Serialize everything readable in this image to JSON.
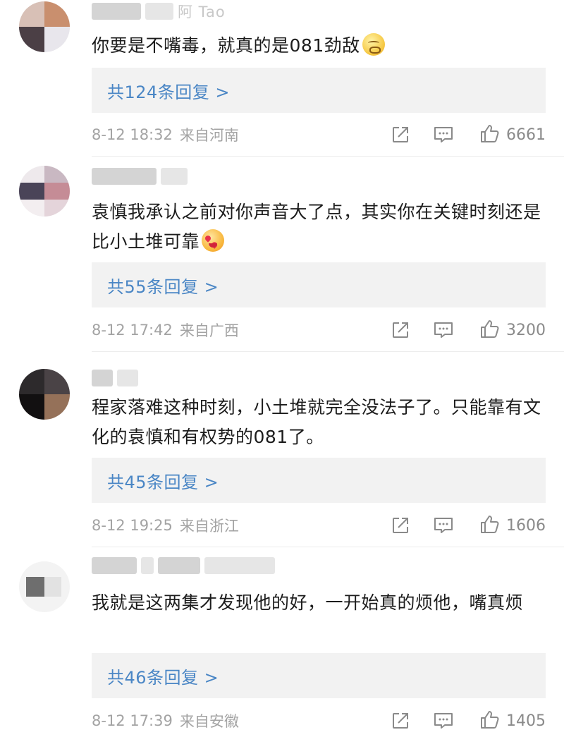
{
  "comments": [
    {
      "username_fragment": "阿 Tao",
      "text": "你要是不嘴毒，就真的是081劲敌",
      "emoji": "grimacing-face",
      "replies_label": "共124条回复 >",
      "date": "8-12 18:32",
      "location": "来自河南",
      "likes": "6661"
    },
    {
      "username_fragment": "",
      "text": "袁慎我承认之前对你声音大了点，其实你在关键时刻还是比小土堆可靠",
      "emoji": "heart-eyes-face",
      "replies_label": "共55条回复 >",
      "date": "8-12 17:42",
      "location": "来自广西",
      "likes": "3200"
    },
    {
      "username_fragment": "",
      "text": "程家落难这种时刻，小土堆就完全没法子了。只能靠有文化的袁慎和有权势的081了。",
      "emoji": "",
      "replies_label": "共45条回复 >",
      "date": "8-12 19:25",
      "location": "来自浙江",
      "likes": "1606"
    },
    {
      "username_fragment": "",
      "text": "我就是这两集才发现他的好，一开始真的烦他，嘴真烦",
      "emoji": "",
      "replies_label": "共46条回复 >",
      "date": "8-12 17:39",
      "location": "来自安徽",
      "likes": "1405"
    }
  ],
  "icons": {
    "share": "share-icon",
    "comment": "comment-icon",
    "like": "thumbs-up-icon"
  },
  "colors": {
    "reply_link": "#4a86c5",
    "meta_text": "#a3a3a3",
    "reply_bg": "#f2f2f2"
  }
}
